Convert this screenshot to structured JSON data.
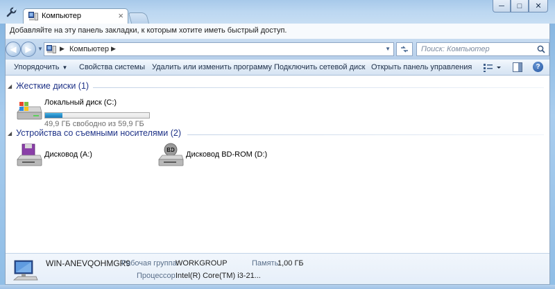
{
  "browser": {
    "tab_title": "Компьютер",
    "tab_close": "×",
    "window_minimize": "─",
    "window_maximize": "□",
    "window_close": "✕",
    "bookmark_hint": "Добавляйте на эту панель закладки, к которым хотите иметь быстрый доступ."
  },
  "address": {
    "path": "Компьютер",
    "search_placeholder": "Поиск: Компьютер"
  },
  "toolbar": {
    "organize": "Упорядочить",
    "system_properties": "Свойства системы",
    "uninstall": "Удалить или изменить программу",
    "map_drive": "Подключить сетевой диск",
    "control_panel": "Открыть панель управления"
  },
  "groups": {
    "hard_disks": "Жесткие диски (1)",
    "removable": "Устройства со съемными носителями (2)"
  },
  "drives": {
    "local_c": {
      "name": "Локальный диск (C:)",
      "free_text": "49,9 ГБ свободно из 59,9 ГБ",
      "used_fraction": 0.167
    },
    "floppy_a": {
      "name": "Дисковод (A:)"
    },
    "bdrom_d": {
      "name": "Дисковод BD-ROM (D:)",
      "badge": "BD"
    }
  },
  "details": {
    "computer_name": "WIN-ANEVQOHMGR9",
    "workgroup_label": "Рабочая группа:",
    "workgroup_value": "WORKGROUP",
    "memory_label": "Память:",
    "memory_value": "1,00 ГБ",
    "cpu_label": "Процессор:",
    "cpu_value": "Intel(R) Core(TM) i3-21..."
  },
  "colors": {
    "group_header": "#1e3287",
    "progress": "#2691cd",
    "frame": "#a9cdee"
  }
}
